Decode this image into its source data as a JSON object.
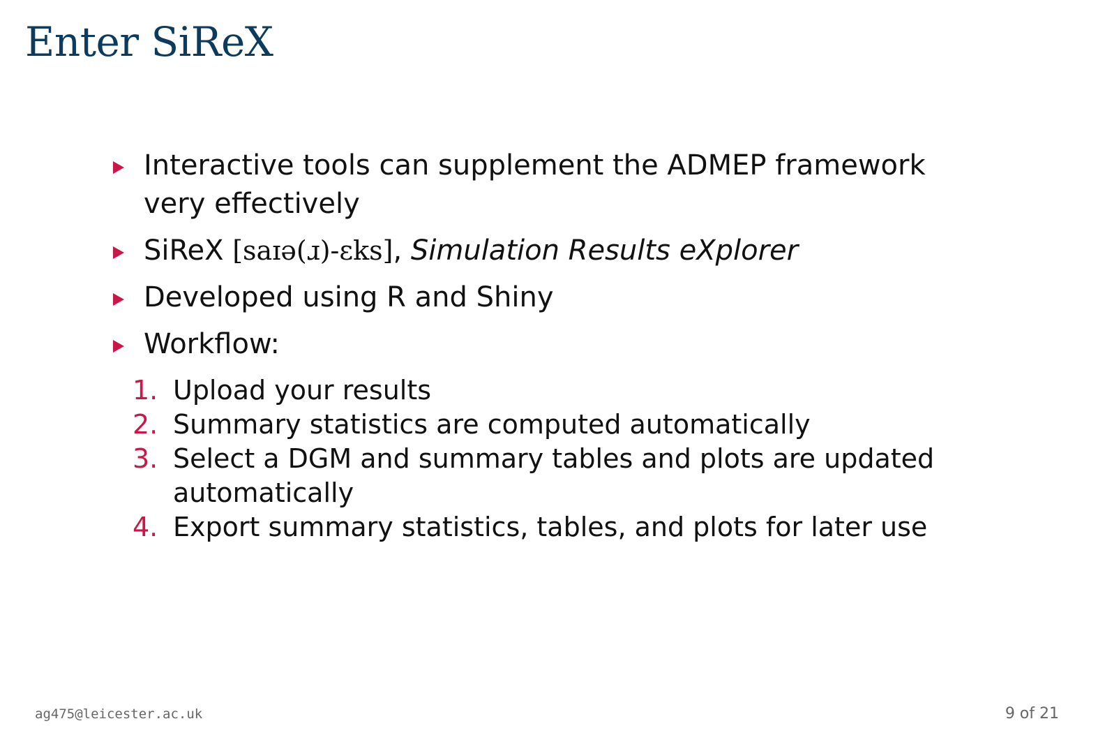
{
  "slide": {
    "title": "Enter SiReX"
  },
  "bullets": [
    {
      "text_line1": "Interactive tools can supplement the ADMEP framework",
      "text_line2": "very effectively"
    },
    {
      "name": "SiReX",
      "pronunciation": "[saɪə(ɹ)-ɛks]",
      "separator": ",",
      "expansion": "Simulation Results eXplorer"
    },
    {
      "text": "Developed using R and Shiny"
    },
    {
      "text": "Workflow:"
    }
  ],
  "workflow_steps": [
    {
      "number": "1.",
      "text": "Upload your results"
    },
    {
      "number": "2.",
      "text": "Summary statistics are computed automatically"
    },
    {
      "number": "3.",
      "text_line1": "Select a DGM and summary tables and plots are updated",
      "text_line2": "automatically"
    },
    {
      "number": "4.",
      "text": "Export summary statistics, tables, and plots for later use"
    }
  ],
  "footer": {
    "email": "ag475@leicester.ac.uk",
    "page_indicator": "9 of 21"
  },
  "colors": {
    "title": "#0d3b5e",
    "accent": "#c8184a",
    "body_text": "#111111",
    "footer_text": "#666666"
  }
}
